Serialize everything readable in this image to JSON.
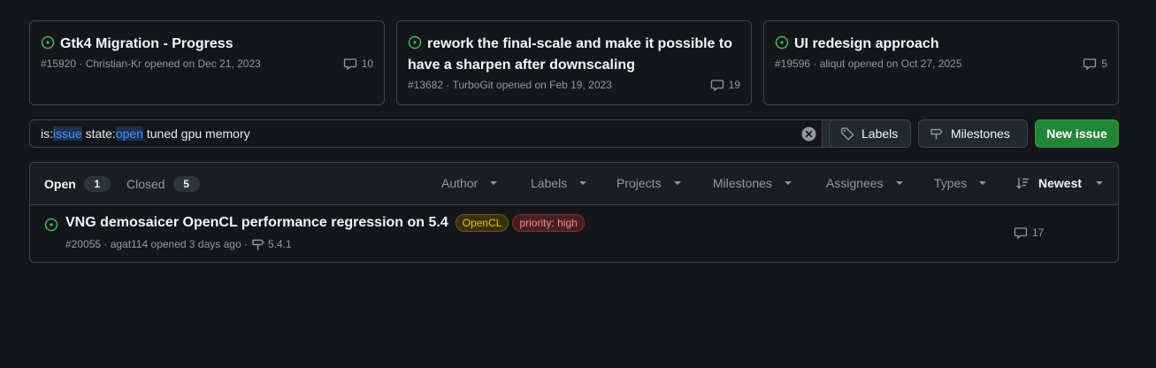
{
  "pinned": [
    {
      "title": "Gtk4 Migration - Progress",
      "meta": "#15920 · Christian-Kr opened on Dec 21, 2023",
      "comments": "10"
    },
    {
      "title": "rework the final-scale and make it possible to have a sharpen after downscaling",
      "meta": "#13682 · TurboGit opened on Feb 19, 2023",
      "comments": "19"
    },
    {
      "title": "UI redesign approach",
      "meta": "#19596 · aliqut opened on Oct 27, 2025",
      "comments": "5"
    }
  ],
  "search": {
    "prefix1": "is:",
    "value1": "issue",
    "prefix2": " state:",
    "value2": "open",
    "rest": " tuned gpu memory"
  },
  "toolbar": {
    "labels": "Labels",
    "milestones": "Milestones",
    "new_issue": "New issue"
  },
  "states": {
    "open_label": "Open",
    "open_count": "1",
    "closed_label": "Closed",
    "closed_count": "5"
  },
  "filters": [
    "Author",
    "Labels",
    "Projects",
    "Milestones",
    "Assignees",
    "Types"
  ],
  "sort": "Newest",
  "issue": {
    "title": "VNG demosaicer OpenCL performance regression on 5.4",
    "labels": [
      {
        "name": "OpenCL",
        "color": "#e3c51a"
      },
      {
        "name": "priority: high",
        "color": "#f08b8b"
      }
    ],
    "meta": "#20055 · agat114 opened 3 days ago ·",
    "milestone": "5.4.1",
    "comments": "17"
  },
  "colors": {
    "background": "#14161b",
    "open_green": "#3fb950",
    "primary_button": "#238636",
    "accent_blue": "#4493f8"
  }
}
